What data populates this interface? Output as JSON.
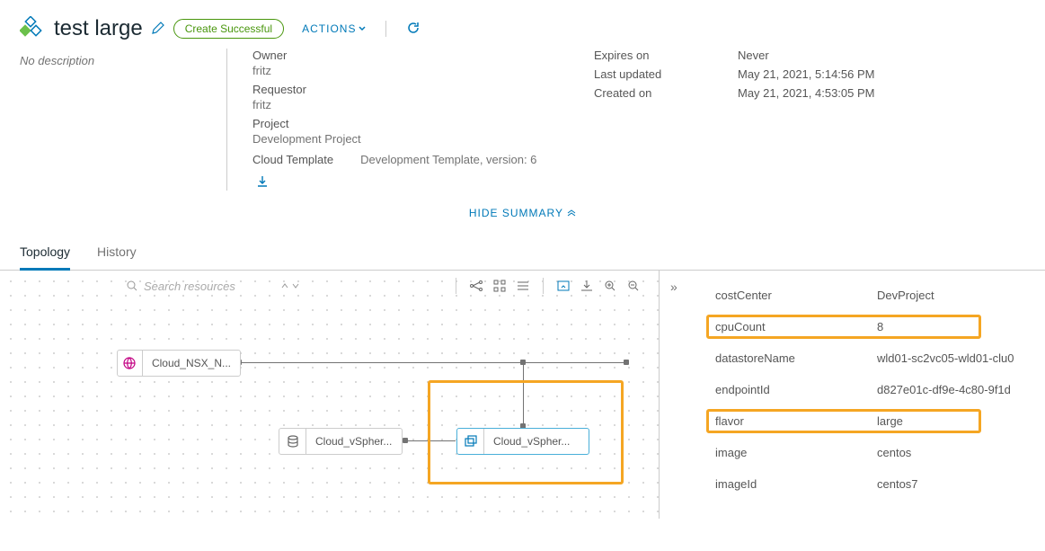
{
  "header": {
    "title": "test large",
    "status": "Create Successful",
    "actions_label": "ACTIONS"
  },
  "summary": {
    "description": "No description",
    "owner_label": "Owner",
    "owner_value": "fritz",
    "requestor_label": "Requestor",
    "requestor_value": "fritz",
    "project_label": "Project",
    "project_value": "Development Project",
    "template_label": "Cloud Template",
    "template_value": "Development Template, version: 6",
    "expires_label": "Expires on",
    "expires_value": "Never",
    "updated_label": "Last updated",
    "updated_value": "May 21, 2021, 5:14:56 PM",
    "created_label": "Created on",
    "created_value": "May 21, 2021, 4:53:05 PM",
    "hide_label": "HIDE SUMMARY"
  },
  "tabs": {
    "topology": "Topology",
    "history": "History"
  },
  "canvas": {
    "search_placeholder": "Search resources",
    "node_nsx": "Cloud_NSX_N...",
    "node_ds": "Cloud_vSpher...",
    "node_vm": "Cloud_vSpher..."
  },
  "props": {
    "costCenter_k": "costCenter",
    "costCenter_v": "DevProject",
    "cpuCount_k": "cpuCount",
    "cpuCount_v": "8",
    "datastoreName_k": "datastoreName",
    "datastoreName_v": "wld01-sc2vc05-wld01-clu0",
    "endpointId_k": "endpointId",
    "endpointId_v": "d827e01c-df9e-4c80-9f1d",
    "flavor_k": "flavor",
    "flavor_v": "large",
    "image_k": "image",
    "image_v": "centos",
    "imageId_k": "imageId",
    "imageId_v": "centos7"
  }
}
